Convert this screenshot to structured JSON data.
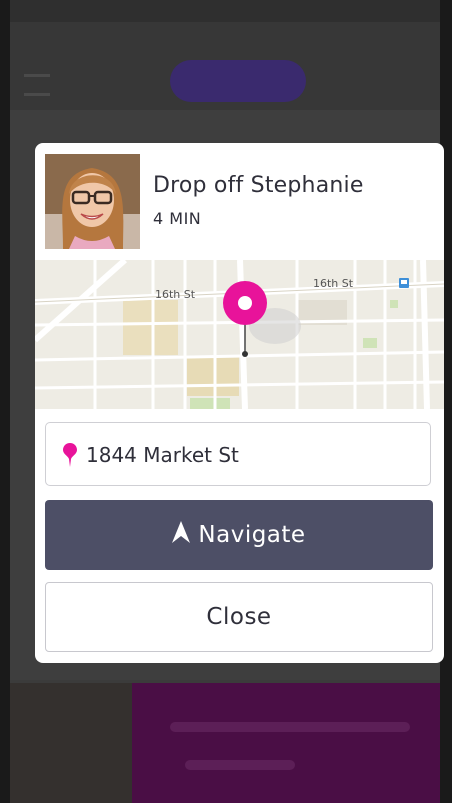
{
  "ride": {
    "action_title": "Drop off Stephanie",
    "eta": "4 MIN"
  },
  "map": {
    "street_labels": [
      "16th St",
      "16th St"
    ],
    "pin_icon": "map-pin-icon",
    "pin_color": "#e8139a"
  },
  "address": {
    "icon": "location-pin-icon",
    "text": "1844 Market St"
  },
  "actions": {
    "navigate_label": "Navigate",
    "navigate_icon": "navigation-arrow-icon",
    "close_label": "Close"
  },
  "colors": {
    "accent": "#e8139a",
    "navigate_bg": "#4d4f66",
    "text": "#2f2f3a"
  }
}
